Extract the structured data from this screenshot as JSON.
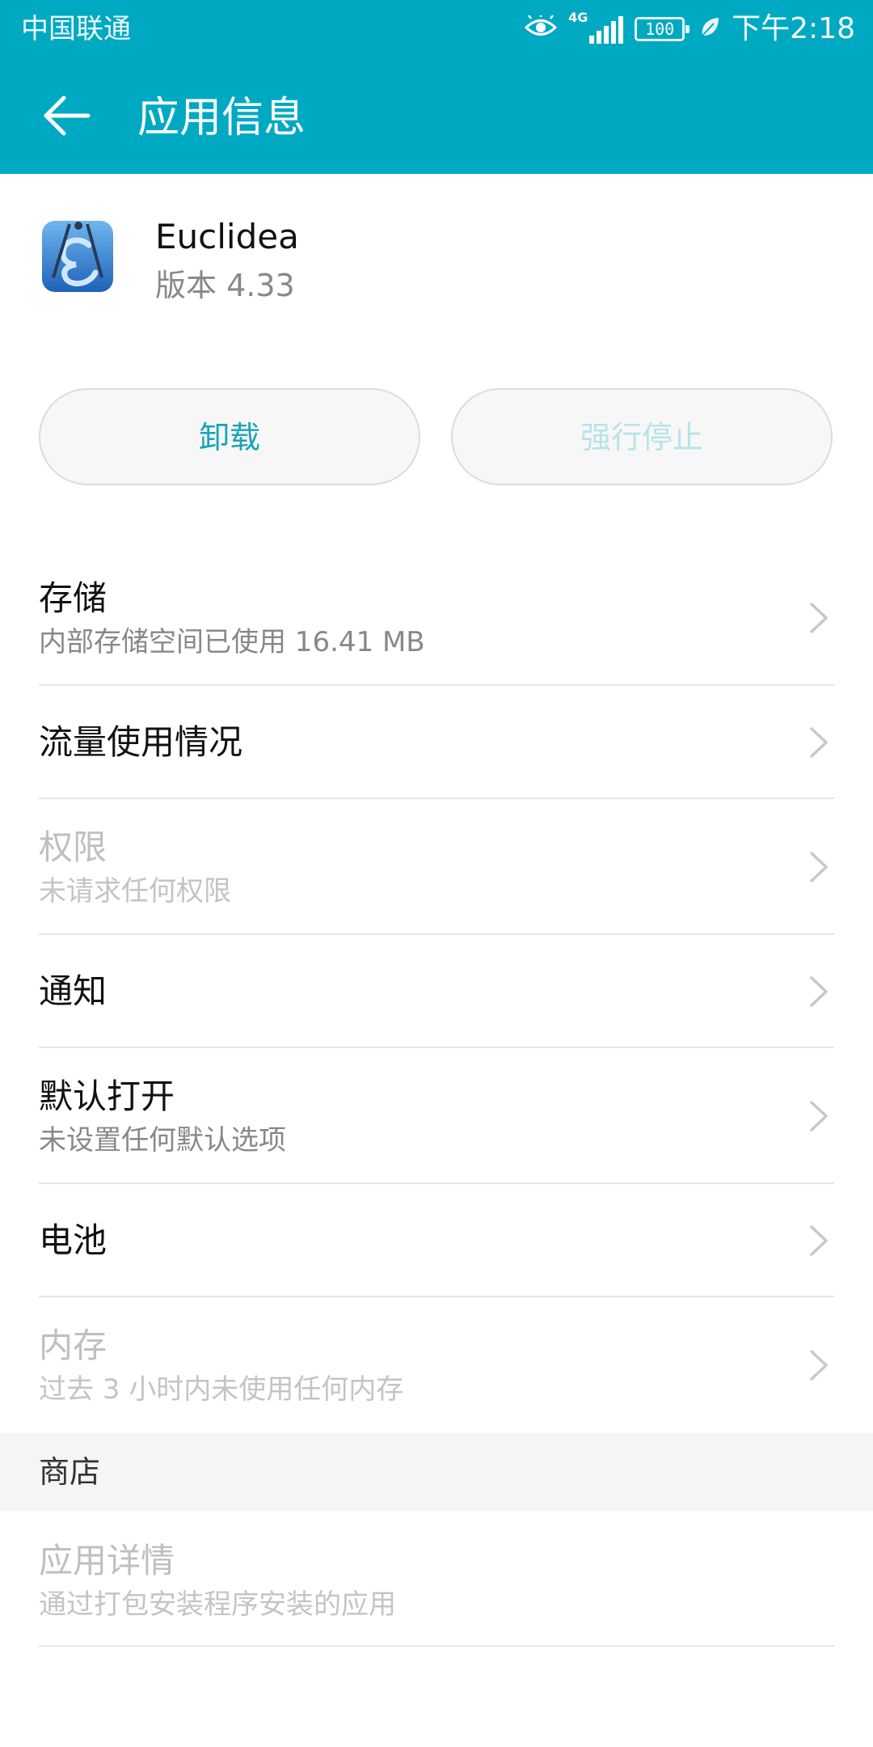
{
  "theme": {
    "header_bg": "#00A9C2",
    "accent": "#1AA3B8",
    "accent_disabled": "#B7E3EA"
  },
  "status_bar": {
    "carrier": "中国联通",
    "network": "4G",
    "battery": "100",
    "time": "下午2:18",
    "icons": [
      "eye-icon",
      "signal-icon",
      "battery-icon",
      "leaf-icon"
    ]
  },
  "app_bar": {
    "back_icon": "arrow-left-icon",
    "title": "应用信息"
  },
  "app": {
    "name": "Euclidea",
    "version": "版本 4.33",
    "icon": "euclidea-app-icon"
  },
  "buttons": {
    "uninstall": "卸载",
    "force_stop": "强行停止"
  },
  "settings": {
    "storage": {
      "title": "存储",
      "subtitle": "内部存储空间已使用 16.41 MB"
    },
    "data_usage": {
      "title": "流量使用情况"
    },
    "permissions": {
      "title": "权限",
      "subtitle": "未请求任何权限"
    },
    "notifications": {
      "title": "通知"
    },
    "open_by_default": {
      "title": "默认打开",
      "subtitle": "未设置任何默认选项"
    },
    "battery": {
      "title": "电池"
    },
    "memory": {
      "title": "内存",
      "subtitle": "过去 3 小时内未使用任何内存"
    }
  },
  "store": {
    "header": "商店",
    "app_details": {
      "title": "应用详情",
      "subtitle": "通过打包安装程序安装的应用"
    }
  }
}
